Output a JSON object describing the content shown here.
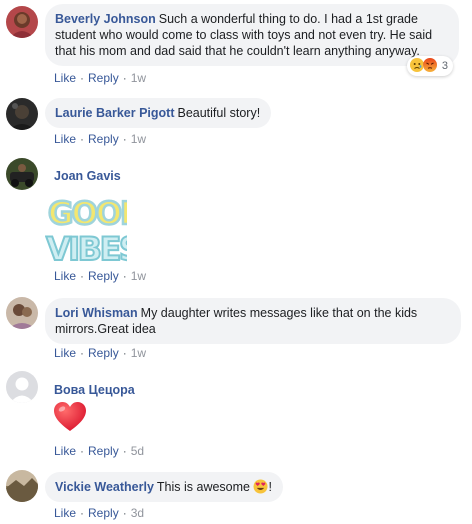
{
  "comments": [
    {
      "author": "Beverly Johnson",
      "text": "Such a wonderful thing to do. I had a 1st grade student who would come to class with toys and not even try. He said that his mom and dad said that he couldn't learn anything anyway.",
      "line1": "Such a wonderful thing to do. I had a 1st grade",
      "line2": "student who would come to class with toys and not even try. He said",
      "line3": "that his mom and dad said that he couldn't learn anything anyway.",
      "like": "Like",
      "reply": "Reply",
      "time": "1w",
      "reactions": {
        "icons": [
          "sad-face-icon",
          "angry-face-icon"
        ],
        "count": "3"
      }
    },
    {
      "author": "Laurie Barker Pigott",
      "text": "Beautiful story!",
      "like": "Like",
      "reply": "Reply",
      "time": "1w"
    },
    {
      "author": "Joan Gavis",
      "sticker": {
        "line1": "GOOD",
        "line2": "VIBES"
      },
      "like": "Like",
      "reply": "Reply",
      "time": "1w"
    },
    {
      "author": "Lori Whisman",
      "line1": "My daughter writes messages like that on the kids",
      "line2": "mirrors.Great idea",
      "like": "Like",
      "reply": "Reply",
      "time": "1w"
    },
    {
      "author": "Вова Цецора",
      "emoji": "heart-icon",
      "like": "Like",
      "reply": "Reply",
      "time": "5d"
    },
    {
      "author": "Vickie Weatherly",
      "text_before": "This is awesome",
      "text_after": "!",
      "emoji": "heart-eyes-icon",
      "like": "Like",
      "reply": "Reply",
      "time": "3d"
    }
  ],
  "colors": {
    "author_link": "#385898",
    "bubble_bg": "#f2f3f5",
    "meta_text": "#606770",
    "heart": "#e0245e"
  }
}
